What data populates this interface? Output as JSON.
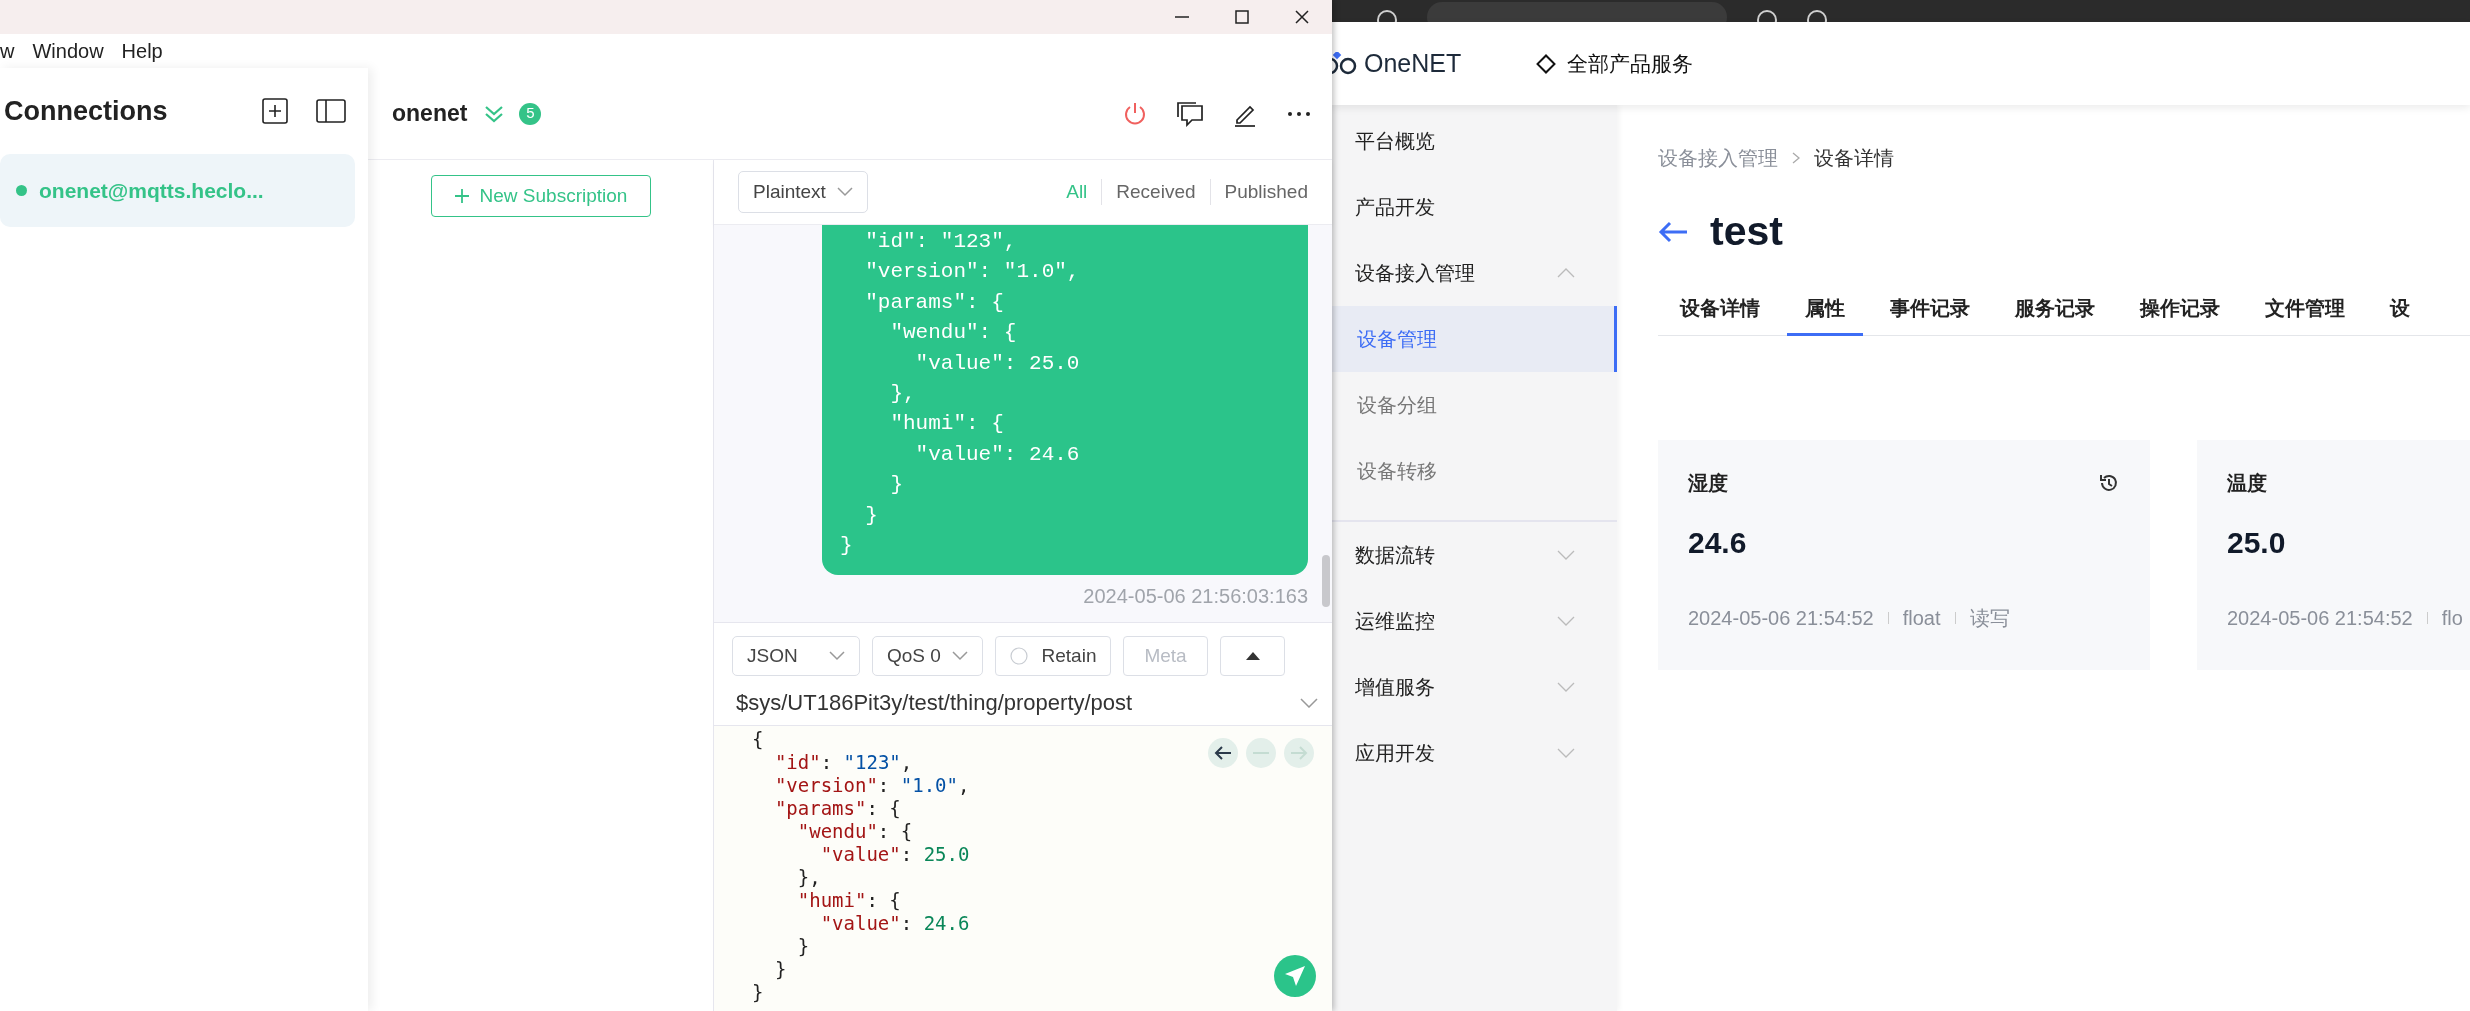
{
  "window": {
    "menu": [
      "w",
      "Window",
      "Help"
    ]
  },
  "connections": {
    "title": "Connections",
    "items": [
      {
        "name": "onenet@mqtts.heclo...",
        "selected": true,
        "online": true
      }
    ]
  },
  "connection_header": {
    "name": "onenet",
    "badge": "5",
    "connected": true
  },
  "subscriptions": {
    "button": "New Subscription"
  },
  "messages": {
    "format": "Plaintext",
    "filters": [
      {
        "label": "All",
        "selected": true
      },
      {
        "label": "Received",
        "selected": false
      },
      {
        "label": "Published",
        "selected": false
      }
    ],
    "items": [
      {
        "lines": [
          "  \"id\": \"123\",",
          "  \"version\": \"1.0\",",
          "  \"params\": {",
          "    \"wendu\": {",
          "      \"value\": 25.0",
          "    },",
          "    \"humi\": {",
          "      \"value\": 24.6",
          "    }",
          "  }",
          "}"
        ],
        "time": "2024-05-06 21:56:03:163"
      }
    ]
  },
  "composer": {
    "format": "JSON",
    "qos": "QoS 0",
    "retain": {
      "label": "Retain",
      "checked": false
    },
    "meta": "Meta",
    "topic": "$sys/UT186Pit3y/test/thing/property/post",
    "lines": [
      "{",
      "  \"id\": \"123\",",
      "  \"version\": \"1.0\",",
      "  \"params\": {",
      "    \"wendu\": {",
      "      \"value\": 25.0",
      "    },",
      "    \"humi\": {",
      "      \"value\": 24.6",
      "    }",
      "  }",
      "}"
    ]
  },
  "onenet": {
    "logo": "OneNET",
    "products": "全部产品服务",
    "menu": [
      {
        "kind": "link",
        "label": "平台概览"
      },
      {
        "kind": "link",
        "label": "产品开发"
      },
      {
        "kind": "group",
        "label": "设备接入管理",
        "expanded": true,
        "children": [
          {
            "label": "设备管理",
            "selected": true
          },
          {
            "label": "设备分组",
            "selected": false
          },
          {
            "label": "设备转移",
            "selected": false
          }
        ]
      },
      {
        "kind": "group",
        "label": "数据流转",
        "expanded": false
      },
      {
        "kind": "group",
        "label": "运维监控",
        "expanded": false
      },
      {
        "kind": "group",
        "label": "增值服务",
        "expanded": false
      },
      {
        "kind": "group",
        "label": "应用开发",
        "expanded": false
      }
    ],
    "breadcrumb": [
      "设备接入管理",
      "设备详情"
    ],
    "title": "test",
    "tabs": [
      {
        "label": "设备详情",
        "selected": false
      },
      {
        "label": "属性",
        "selected": true
      },
      {
        "label": "事件记录",
        "selected": false
      },
      {
        "label": "服务记录",
        "selected": false
      },
      {
        "label": "操作记录",
        "selected": false
      },
      {
        "label": "文件管理",
        "selected": false
      },
      {
        "label": "设",
        "selected": false
      }
    ],
    "cards": [
      {
        "title": "湿度",
        "value": "24.6",
        "history": true,
        "meta": [
          "2024-05-06 21:54:52",
          "float",
          "读写"
        ]
      },
      {
        "title": "温度",
        "value": "25.0",
        "history": false,
        "meta": [
          "2024-05-06 21:54:52",
          "flo"
        ]
      }
    ]
  }
}
